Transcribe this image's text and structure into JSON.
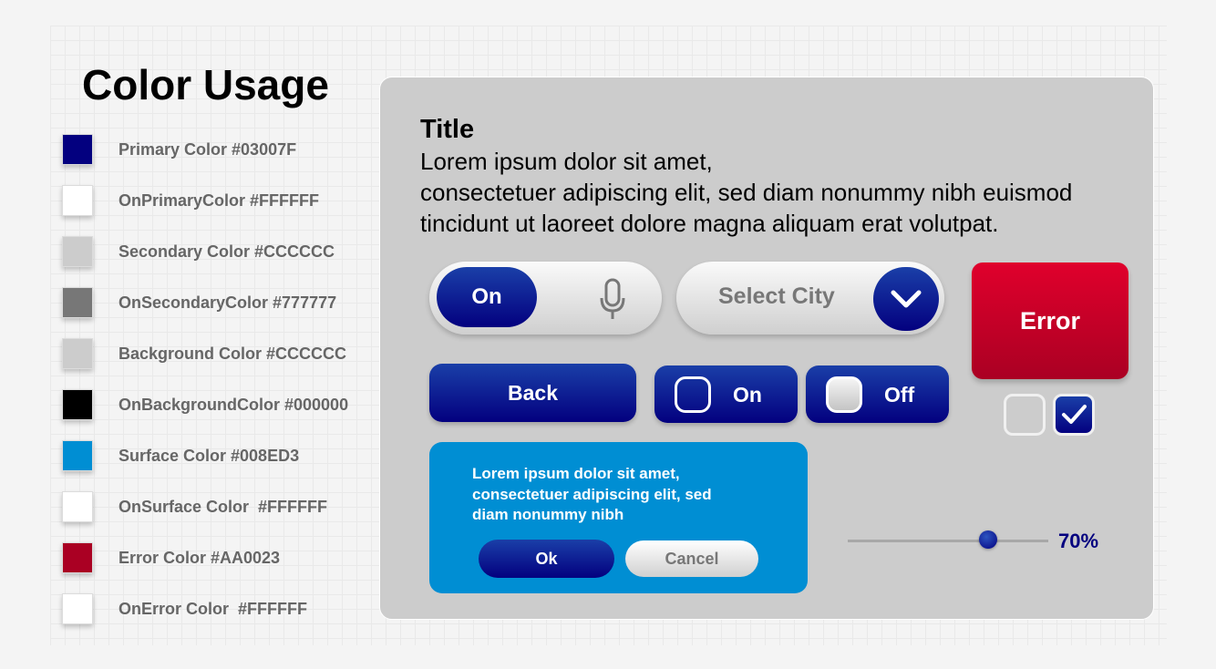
{
  "heading": "Color Usage",
  "palette": [
    {
      "label": "Primary Color #03007F",
      "color": "#03007F"
    },
    {
      "label": "OnPrimaryColor #FFFFFF",
      "color": "#FFFFFF"
    },
    {
      "label": "Secondary Color #CCCCCC",
      "color": "#CCCCCC"
    },
    {
      "label": "OnSecondaryColor #777777",
      "color": "#777777"
    },
    {
      "label": "Background Color #CCCCCC",
      "color": "#CCCCCC"
    },
    {
      "label": "OnBackgroundColor #000000",
      "color": "#000000"
    },
    {
      "label": "Surface Color #008ED3",
      "color": "#008ED3"
    },
    {
      "label": "OnSurface Color  #FFFFFF",
      "color": "#FFFFFF"
    },
    {
      "label": "Error Color #AA0023",
      "color": "#AA0023"
    },
    {
      "label": "OnError Color  #FFFFFF",
      "color": "#FFFFFF"
    }
  ],
  "preview": {
    "title": "Title",
    "body_lines": [
      "Lorem ipsum dolor sit amet,",
      "consectetuer adipiscing elit, sed diam nonummy nibh euismod",
      "tincidunt ut laoreet dolore magna aliquam erat volutpat."
    ],
    "toggle_label": "On",
    "toggle_icon": "microphone-icon",
    "select_placeholder": "Select City",
    "select_icon": "chevron-down-icon",
    "error_button": "Error",
    "checkbox_unchecked": false,
    "checkbox_checked": true,
    "back_button": "Back",
    "radio_on_label": "On",
    "radio_off_label": "Off",
    "dialog": {
      "lines": [
        "Lorem ipsum dolor sit amet,",
        "consectetuer adipiscing elit, sed",
        "diam nonummy nibh"
      ],
      "ok": "Ok",
      "cancel": "Cancel"
    },
    "slider": {
      "value": 0.7,
      "label": "70%"
    }
  }
}
